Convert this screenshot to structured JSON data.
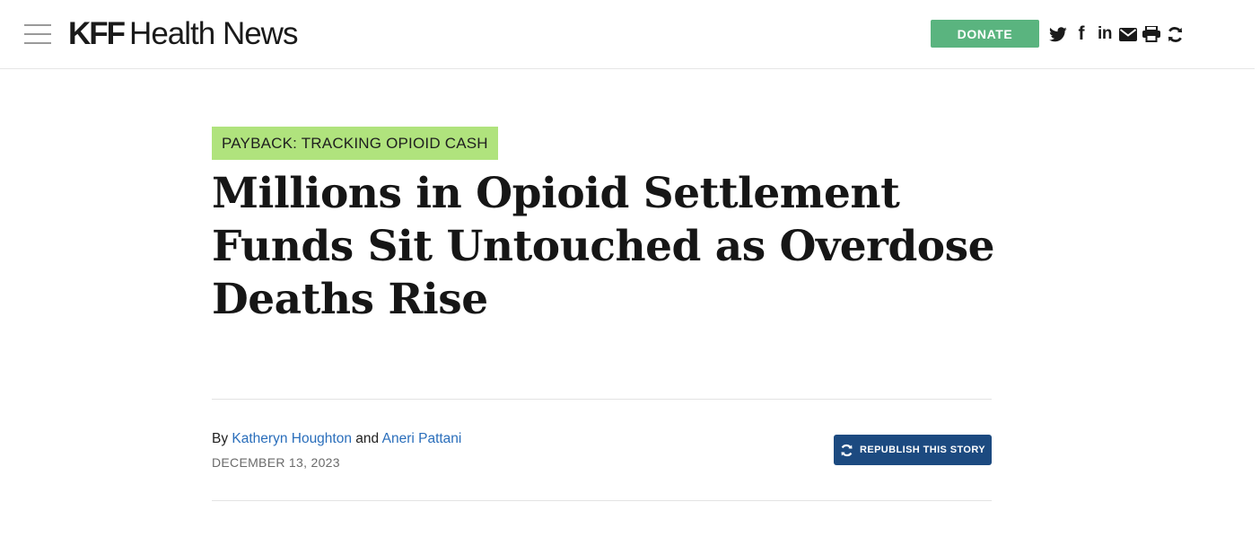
{
  "header": {
    "logo_brand": "KFF",
    "logo_name": "Health News",
    "donate_label": "DONATE",
    "share_icons": [
      "twitter-icon",
      "facebook-icon",
      "linkedin-icon",
      "email-icon",
      "print-icon",
      "republish-icon"
    ],
    "facebook_glyph": "f",
    "linkedin_glyph": "in"
  },
  "article": {
    "tag": "PAYBACK: TRACKING OPIOID CASH",
    "headline": "Millions in Opioid Settlement Funds Sit Untouched as Overdose Deaths Rise",
    "byline_prefix": "By",
    "author_1": "Katheryn Houghton",
    "byline_join": "and",
    "author_2": "Aneri Pattani",
    "date": "DECEMBER 13, 2023",
    "republish_label": "REPUBLISH THIS STORY"
  },
  "colors": {
    "donate": "#5ab47f",
    "tag_background": "#b0e37d",
    "link": "#2a6ebb",
    "republish_button": "#1c4a80"
  }
}
